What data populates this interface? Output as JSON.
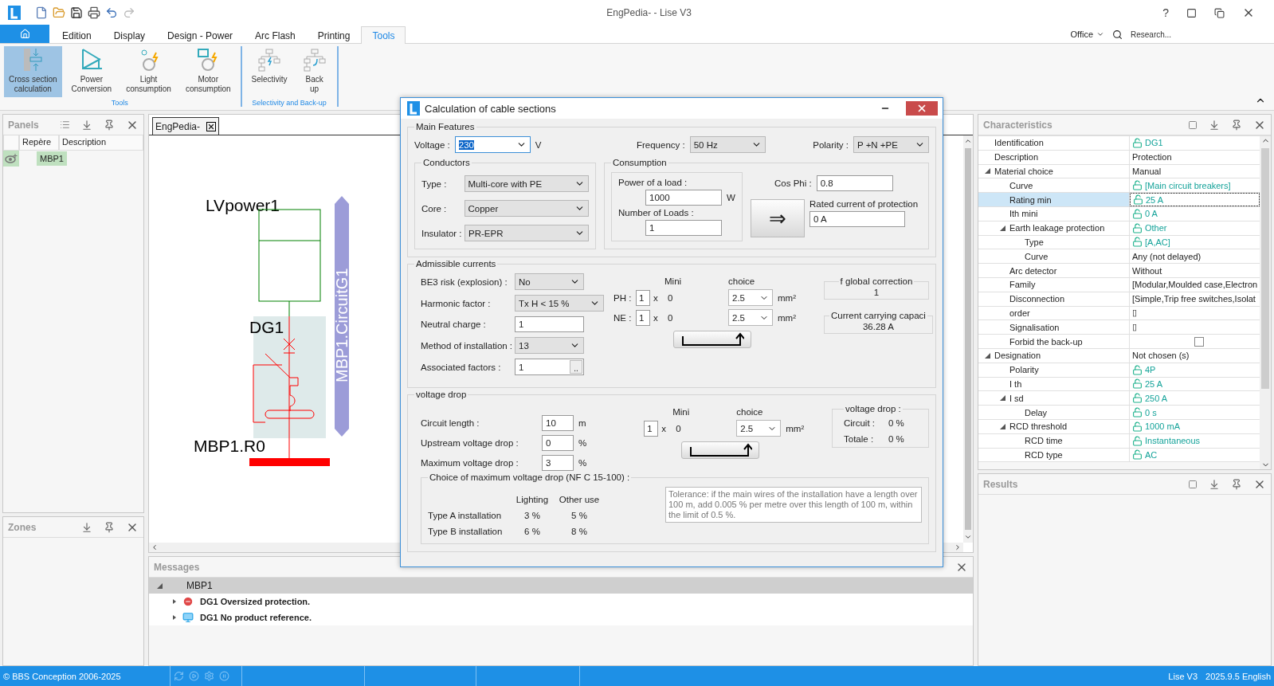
{
  "window": {
    "title": "EngPedia- - Lise V3",
    "help": "?"
  },
  "ribbon": {
    "tabs": [
      {
        "kind": "home",
        "selected": false
      },
      {
        "kind": "text",
        "label": "Edition",
        "selected": false
      },
      {
        "kind": "text",
        "label": "Display",
        "selected": false
      },
      {
        "kind": "text",
        "label": "Design - Power",
        "selected": false
      },
      {
        "kind": "text",
        "label": "Arc Flash",
        "selected": false
      },
      {
        "kind": "text",
        "label": "Printing",
        "selected": false
      },
      {
        "kind": "text",
        "label": "Tools",
        "selected": true
      }
    ],
    "office": "Office",
    "search": {
      "placeholder": "Research..."
    },
    "groups": [
      {
        "label": "Tools",
        "buttons": [
          {
            "kind": "cross_section",
            "label": "Cross section\ncalculation",
            "selected": true
          },
          {
            "kind": "power",
            "label": "Power\nConversion",
            "selected": false
          },
          {
            "kind": "light",
            "label": "Light\nconsumption",
            "selected": false
          },
          {
            "kind": "motor",
            "label": "Motor\nconsumption",
            "selected": false
          }
        ]
      },
      {
        "label": "Selectivity and Back-up",
        "buttons": [
          {
            "kind": "selectivity",
            "label": "Selectivity",
            "selected": false
          },
          {
            "kind": "backup",
            "label": "Back\nup",
            "selected": false
          }
        ]
      }
    ]
  },
  "panels": {
    "title": "Panels",
    "columns": [
      "Repère",
      "Description"
    ],
    "rows": [
      {
        "repere": "MBP1",
        "selected": true
      }
    ]
  },
  "zones": {
    "title": "Zones"
  },
  "document": {
    "tab": "EngPedia-",
    "diagram": {
      "source": "LVpower1",
      "breaker": "DG1",
      "busbar": "MBP1.R0",
      "circuit": "MBP1.CircuitG1"
    }
  },
  "messages": {
    "title": "Messages",
    "groups": [
      {
        "label": "MBP1",
        "expanded": true,
        "items": [
          {
            "kind": "error",
            "text": "DG1 Oversized protection."
          },
          {
            "kind": "info",
            "text": "DG1 No product reference."
          }
        ]
      }
    ]
  },
  "characteristics": {
    "title": "Characteristics",
    "rows": [
      {
        "label": "Identification",
        "value": "DG1",
        "kind": "lock",
        "selected": false
      },
      {
        "label": "Description",
        "value": "Protection",
        "kind": "text",
        "selected": false
      },
      {
        "label": "Material choice",
        "value": "Manual",
        "kind": "text",
        "selected": false,
        "expanded": true,
        "children": [
          {
            "label": "Curve",
            "value": "[Main circuit breakers]",
            "kind": "lock",
            "selected": false
          },
          {
            "label": "Rating min",
            "value": "25 A",
            "kind": "lock",
            "selected": true
          },
          {
            "label": "Ith mini",
            "value": "0 A",
            "kind": "lock",
            "selected": false
          },
          {
            "label": "Earth leakage protection",
            "value": "Other",
            "kind": "lock",
            "selected": false,
            "expanded": true,
            "children": [
              {
                "label": "Type",
                "value": "[A,AC]",
                "kind": "lock",
                "selected": false
              },
              {
                "label": "Curve",
                "value": "Any (not delayed)",
                "kind": "text",
                "selected": false
              }
            ]
          },
          {
            "label": "Arc detector",
            "value": "Without",
            "kind": "text",
            "selected": false
          },
          {
            "label": "Family",
            "value": "[Modular,Moulded case,Electron",
            "kind": "text",
            "selected": false
          },
          {
            "label": "Disconnection",
            "value": "[Simple,Trip free switches,Isolat",
            "kind": "text",
            "selected": false
          },
          {
            "label": "order",
            "value": "▯",
            "kind": "text",
            "selected": false
          },
          {
            "label": "Signalisation",
            "value": "▯",
            "kind": "text",
            "selected": false
          },
          {
            "label": "Forbid the back-up",
            "kind": "checkbox",
            "checked": false,
            "selected": false
          }
        ]
      },
      {
        "label": "Designation",
        "value": "Not chosen (s)",
        "kind": "text",
        "selected": false,
        "expanded": true,
        "children": [
          {
            "label": "Polarity",
            "value": "4P",
            "kind": "lock",
            "selected": false
          },
          {
            "label": "I th",
            "value": "25 A",
            "kind": "lock",
            "selected": false
          },
          {
            "label": "I sd",
            "value": "250 A",
            "kind": "lock",
            "selected": false,
            "expanded": true,
            "children": [
              {
                "label": "Delay",
                "value": "0 s",
                "kind": "lock",
                "selected": false
              }
            ]
          },
          {
            "label": "RCD threshold",
            "value": "1000 mA",
            "kind": "lock",
            "selected": false,
            "expanded": true,
            "children": [
              {
                "label": "RCD time",
                "value": "Instantaneous",
                "kind": "lock",
                "selected": false
              },
              {
                "label": "RCD type",
                "value": "AC",
                "kind": "lock",
                "selected": false
              }
            ]
          }
        ]
      }
    ]
  },
  "results": {
    "title": "Results"
  },
  "dialog": {
    "title": "Calculation of cable sections",
    "main": {
      "title": "Main Features",
      "voltage": {
        "label": "Voltage :",
        "value": "230",
        "unit": "V",
        "text_selected": true
      },
      "frequency": {
        "label": "Frequency :",
        "value": "50 Hz"
      },
      "polarity": {
        "label": "Polarity :",
        "value": "P +N +PE"
      },
      "conductors": {
        "title": "Conductors",
        "fields": [
          {
            "label": "Type :",
            "value": "Multi-core with PE"
          },
          {
            "label": "Core :",
            "value": "Copper"
          },
          {
            "label": "Insulator :",
            "value": "PR-EPR"
          }
        ]
      },
      "consumption": {
        "title": "Consumption",
        "power_label": "Power of a load :",
        "power_value": "1000",
        "power_unit": "W",
        "loads_label": "Number of  Loads :",
        "loads_value": "1",
        "cos_phi_label": "Cos Phi :",
        "cos_phi_value": "0.8",
        "arrow": "⇒",
        "rated_label": "Rated current of protection",
        "rated_value": "0 A"
      }
    },
    "admissible": {
      "title": "Admissible currents",
      "fields": [
        {
          "kind": "select",
          "label": "BE3 risk (explosion) :",
          "value": "No"
        },
        {
          "kind": "select",
          "label": "Harmonic factor :",
          "value": "Tx H < 15 %"
        },
        {
          "kind": "input",
          "label": "Neutral charge :",
          "value": "1"
        },
        {
          "kind": "select",
          "label": "Method of installation :",
          "value": "13"
        },
        {
          "kind": "browse",
          "label": "Associated factors :",
          "value": "1",
          "button": ".."
        }
      ],
      "mini_label": "Mini",
      "choice_label": "choice",
      "rows": [
        {
          "label": "PH :",
          "count": "1",
          "times": "x",
          "mini": "0",
          "choice": "2.5",
          "unit": "mm²"
        },
        {
          "label": "NE :",
          "count": "1",
          "times": "x",
          "mini": "0",
          "choice": "2.5",
          "unit": "mm²"
        }
      ],
      "correction": {
        "title": "f global correction",
        "value": "1"
      },
      "capacity": {
        "title": "Current carrying capaci",
        "value": "36.28 A"
      }
    },
    "voltage_drop": {
      "title": "voltage drop",
      "fields": [
        {
          "label": "Circuit length :",
          "value": "10",
          "unit": "m"
        },
        {
          "label": "Upstream voltage drop :",
          "value": "0",
          "unit": "%"
        },
        {
          "label": "Maximum voltage drop :",
          "value": "3",
          "unit": "%"
        }
      ],
      "mini_label": "Mini",
      "choice_label": "choice",
      "row": {
        "count": "1",
        "times": "x",
        "mini": "0",
        "choice": "2.5",
        "unit": "mm²"
      },
      "result": {
        "title": "voltage drop :",
        "items": [
          {
            "label": "Circuit :",
            "value": "0 %"
          },
          {
            "label": "Totale :",
            "value": "0 %"
          }
        ]
      },
      "limits": {
        "title": "Choice of maximum voltage drop (NF C 15-100) :",
        "columns": [
          "Lighting",
          "Other use"
        ],
        "rows": [
          {
            "label": "Type A installation",
            "values": [
              "3 %",
              "5 %"
            ]
          },
          {
            "label": "Type B installation",
            "values": [
              "6 %",
              "8 %"
            ]
          }
        ],
        "tolerance": "Tolerance: if the main wires of the installation have a length over 100 m, add 0.005 % per metre over this length of 100 m, within the limit of 0.5 %."
      }
    }
  },
  "status_bar": {
    "copyright": "© BBS Conception 2006-2025",
    "product": "Lise V3",
    "version": "2025.9.5 English"
  }
}
